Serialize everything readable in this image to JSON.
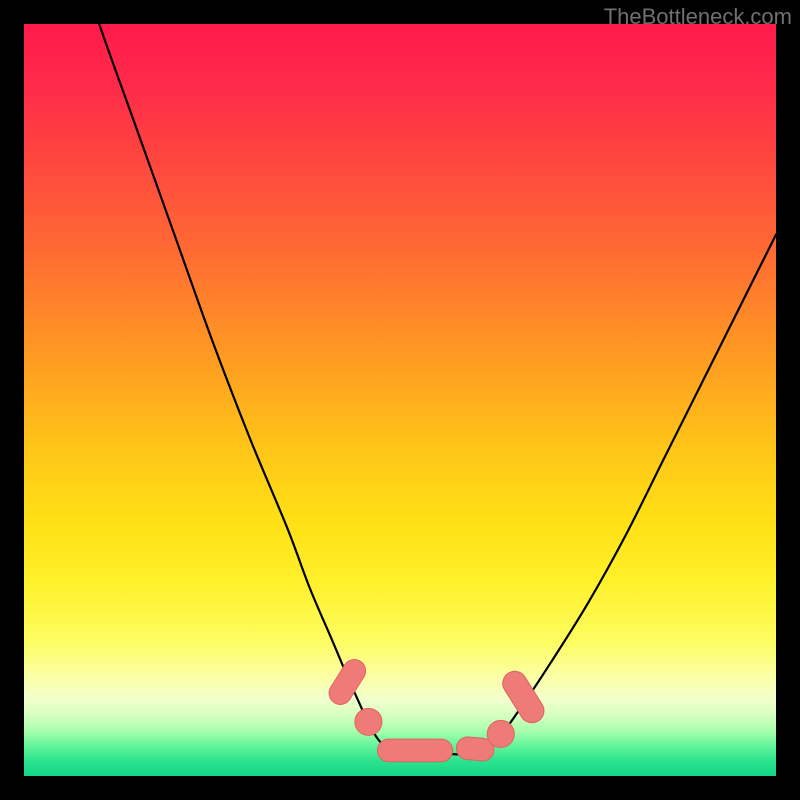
{
  "watermark": "TheBottleneck.com",
  "colors": {
    "page_bg": "#000000",
    "watermark": "#707070",
    "curve": "#000000",
    "marker_fill": "#ef7b78",
    "marker_stroke": "#e06360",
    "gradient_top": "#ff1a4b",
    "gradient_bottom": "#14d688"
  },
  "chart_data": {
    "type": "line",
    "title": "",
    "xlabel": "",
    "ylabel": "",
    "xlim": [
      0,
      100
    ],
    "ylim": [
      0,
      100
    ],
    "note": "Bottleneck-style V-curve. y≈100 is top (red / high bottleneck), y≈0 is bottom (green / balanced). Valley floor ~y≈3 between x≈47 and x≈63. x/y in percent of plot area.",
    "series": [
      {
        "name": "curve",
        "x": [
          0,
          5,
          10,
          15,
          20,
          25,
          30,
          35,
          38,
          41,
          44,
          47,
          50,
          55,
          60,
          63,
          66,
          70,
          75,
          80,
          85,
          90,
          95,
          100
        ],
        "y": [
          130,
          115,
          100,
          86,
          72,
          58,
          45,
          33,
          25,
          18,
          11,
          5,
          3,
          3,
          3,
          5,
          9,
          15,
          23,
          32,
          42,
          52,
          62,
          72
        ]
      }
    ],
    "markers": [
      {
        "shape": "pill",
        "cx": 43.0,
        "cy": 12.5,
        "w": 3.0,
        "h": 6.5,
        "rot": 32
      },
      {
        "shape": "circle",
        "cx": 45.8,
        "cy": 7.2,
        "r": 1.8
      },
      {
        "shape": "pill",
        "cx": 52.0,
        "cy": 3.4,
        "w": 10.0,
        "h": 3.0,
        "rot": 0
      },
      {
        "shape": "pill",
        "cx": 60.0,
        "cy": 3.6,
        "w": 5.0,
        "h": 3.0,
        "rot": 5
      },
      {
        "shape": "circle",
        "cx": 63.4,
        "cy": 5.6,
        "r": 1.8
      },
      {
        "shape": "pill",
        "cx": 66.4,
        "cy": 10.5,
        "w": 3.2,
        "h": 7.5,
        "rot": -32
      }
    ]
  }
}
